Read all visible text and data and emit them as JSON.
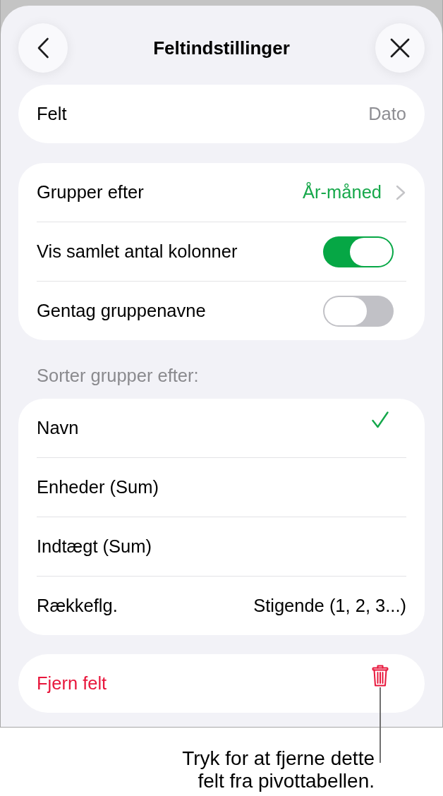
{
  "header": {
    "title": "Feltindstillinger"
  },
  "field": {
    "label": "Felt",
    "value": "Dato"
  },
  "options": [
    {
      "kind": "link",
      "label": "Grupper efter",
      "value": "År-måned"
    },
    {
      "kind": "toggle",
      "label": "Vis samlet antal kolonner",
      "on": true
    },
    {
      "kind": "toggle",
      "label": "Gentag gruppenavne",
      "on": false
    }
  ],
  "sort": {
    "heading": "Sorter grupper efter:",
    "items": [
      {
        "kind": "choice",
        "label": "Navn",
        "selected": true
      },
      {
        "kind": "choice",
        "label": "Enheder (Sum)",
        "selected": false
      },
      {
        "kind": "choice",
        "label": "Indtægt (Sum)",
        "selected": false
      },
      {
        "kind": "value",
        "label": "Rækkeflg.",
        "value": "Stigende (1, 2, 3...)"
      }
    ]
  },
  "remove_button": {
    "label": "Fjern felt"
  },
  "callout": {
    "text": "Tryk for at fjerne dette felt fra pivottabellen."
  }
}
